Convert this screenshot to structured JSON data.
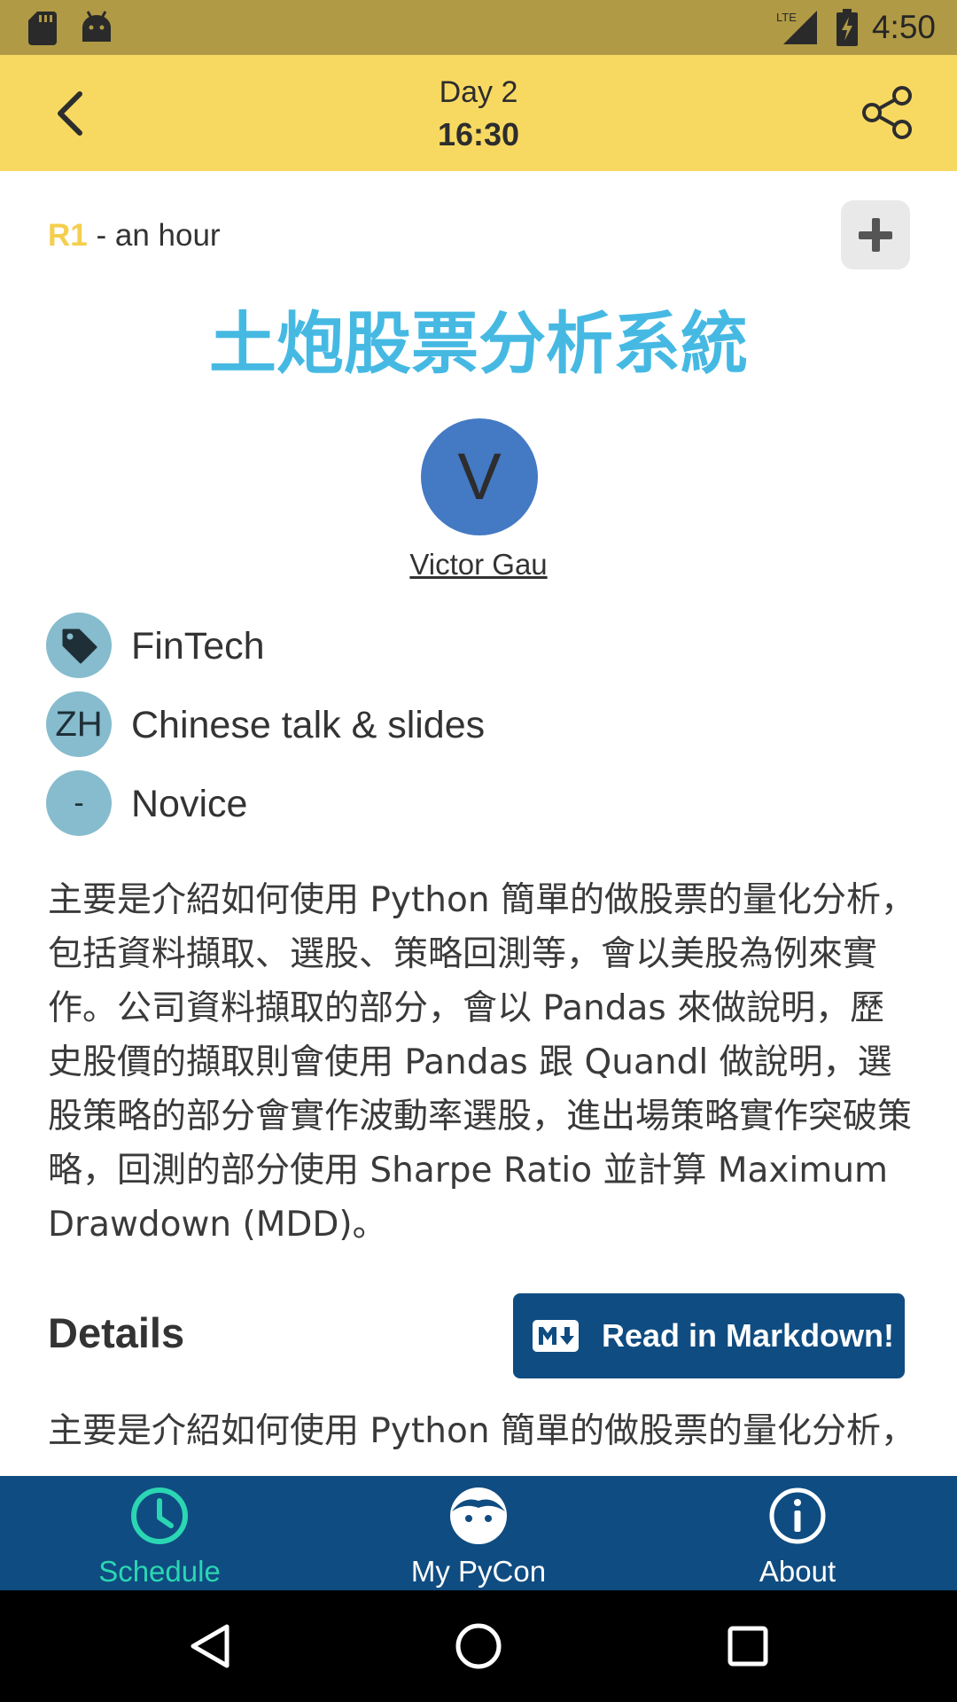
{
  "status_bar": {
    "time": "4:50",
    "icons": [
      "sd-card-icon",
      "android-icon",
      "lte-signal-icon",
      "battery-charging-icon"
    ],
    "network_label": "LTE"
  },
  "app_bar": {
    "title": "Day 2",
    "subtitle": "16:30",
    "background_color": "#f7d962",
    "icons": [
      "back-arrow-icon",
      "share-icon"
    ]
  },
  "session": {
    "room": "R1",
    "duration": "- an hour",
    "title": "土炮股票分析系統",
    "title_color": "#46b9e3",
    "speaker_initial": "V",
    "speaker_name": "Victor Gau",
    "add_icon": "plus-icon",
    "meta": [
      {
        "badge": "tag-icon",
        "text": "FinTech"
      },
      {
        "badge": "ZH",
        "text": "Chinese talk & slides"
      },
      {
        "badge": "-",
        "text": "Novice"
      }
    ],
    "abstract": "主要是介紹如何使用 Python 簡單的做股票的量化分析，包括資料擷取、選股、策略回測等，會以美股為例來實作。公司資料擷取的部分，會以 Pandas 來做說明，歷史股價的擷取則會使用 Pandas 跟 Quandl 做說明，選股策略的部分會實作波動率選股，進出場策略實作突破策略，回測的部分使用 Sharpe Ratio 並計算 Maximum Drawdown (MDD)。"
  },
  "details": {
    "heading": "Details",
    "markdown_button": "Read in Markdown!",
    "markdown_icon": "markdown-icon",
    "body": "主要是介紹如何使用 Python 簡單的做股票的量化分析，"
  },
  "bottom_nav": {
    "background_color": "#0f4c81",
    "active_color": "#2bd6b3",
    "items": [
      {
        "label": "Schedule",
        "icon": "clock-icon",
        "active": true
      },
      {
        "label": "My PyCon",
        "icon": "face-icon",
        "active": false
      },
      {
        "label": "About",
        "icon": "info-icon",
        "active": false
      }
    ]
  },
  "system_nav": {
    "icons": [
      "back-triangle-icon",
      "home-circle-icon",
      "recents-square-icon"
    ]
  }
}
